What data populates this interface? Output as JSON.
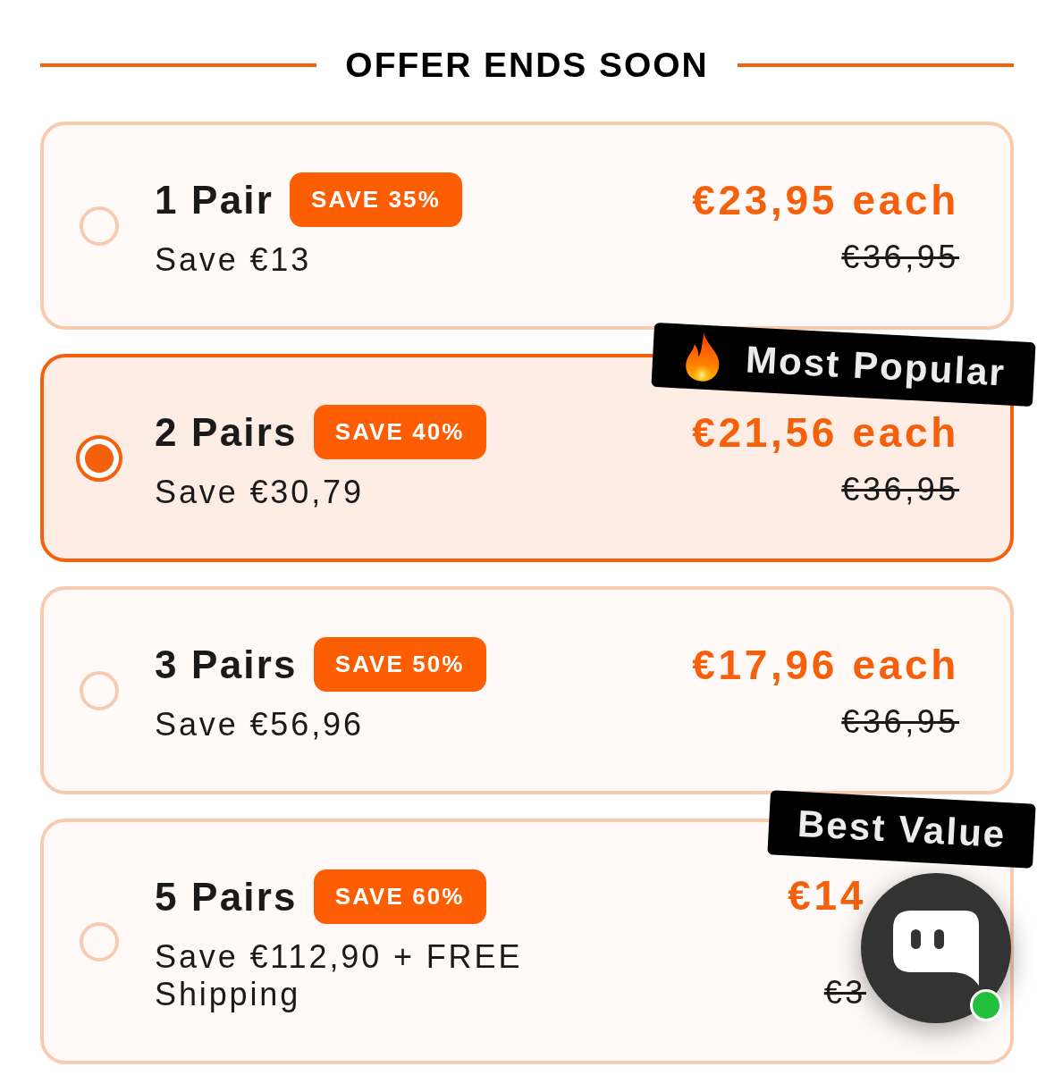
{
  "header": {
    "title": "OFFER ENDS SOON"
  },
  "options": [
    {
      "quantity": "1 Pair",
      "discount": "SAVE 35%",
      "savings": "Save €13",
      "price": "€23,95 each",
      "old_price": "€36,95",
      "selected": false
    },
    {
      "quantity": "2 Pairs",
      "discount": "SAVE 40%",
      "savings": "Save €30,79",
      "price": "€21,56 each",
      "old_price": "€36,95",
      "selected": true,
      "ribbon": {
        "kind": "popular",
        "label": "Most Popular"
      }
    },
    {
      "quantity": "3 Pairs",
      "discount": "SAVE 50%",
      "savings": "Save €56,96",
      "price": "€17,96 each",
      "old_price": "€36,95",
      "selected": false
    },
    {
      "quantity": "5 Pairs",
      "discount": "SAVE 60%",
      "savings": "Save €112,90 + FREE Shipping",
      "price": "€14",
      "old_price": "€3",
      "selected": false,
      "ribbon": {
        "kind": "value",
        "label": "Best Value"
      }
    }
  ],
  "chat_button": {
    "online": true
  }
}
